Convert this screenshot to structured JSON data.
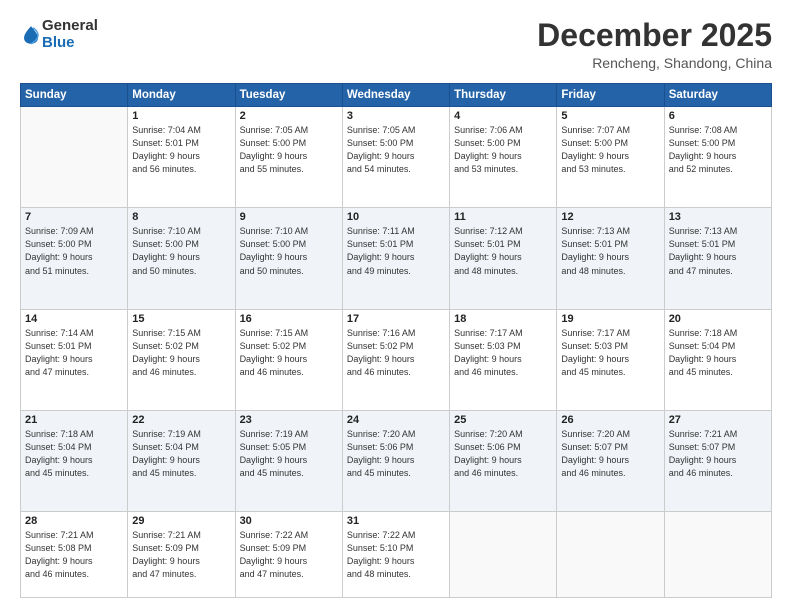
{
  "header": {
    "logo_general": "General",
    "logo_blue": "Blue",
    "month": "December 2025",
    "location": "Rencheng, Shandong, China"
  },
  "days_of_week": [
    "Sunday",
    "Monday",
    "Tuesday",
    "Wednesday",
    "Thursday",
    "Friday",
    "Saturday"
  ],
  "weeks": [
    [
      {
        "day": "",
        "info": ""
      },
      {
        "day": "1",
        "info": "Sunrise: 7:04 AM\nSunset: 5:01 PM\nDaylight: 9 hours\nand 56 minutes."
      },
      {
        "day": "2",
        "info": "Sunrise: 7:05 AM\nSunset: 5:00 PM\nDaylight: 9 hours\nand 55 minutes."
      },
      {
        "day": "3",
        "info": "Sunrise: 7:05 AM\nSunset: 5:00 PM\nDaylight: 9 hours\nand 54 minutes."
      },
      {
        "day": "4",
        "info": "Sunrise: 7:06 AM\nSunset: 5:00 PM\nDaylight: 9 hours\nand 53 minutes."
      },
      {
        "day": "5",
        "info": "Sunrise: 7:07 AM\nSunset: 5:00 PM\nDaylight: 9 hours\nand 53 minutes."
      },
      {
        "day": "6",
        "info": "Sunrise: 7:08 AM\nSunset: 5:00 PM\nDaylight: 9 hours\nand 52 minutes."
      }
    ],
    [
      {
        "day": "7",
        "info": "Sunrise: 7:09 AM\nSunset: 5:00 PM\nDaylight: 9 hours\nand 51 minutes."
      },
      {
        "day": "8",
        "info": "Sunrise: 7:10 AM\nSunset: 5:00 PM\nDaylight: 9 hours\nand 50 minutes."
      },
      {
        "day": "9",
        "info": "Sunrise: 7:10 AM\nSunset: 5:00 PM\nDaylight: 9 hours\nand 50 minutes."
      },
      {
        "day": "10",
        "info": "Sunrise: 7:11 AM\nSunset: 5:01 PM\nDaylight: 9 hours\nand 49 minutes."
      },
      {
        "day": "11",
        "info": "Sunrise: 7:12 AM\nSunset: 5:01 PM\nDaylight: 9 hours\nand 48 minutes."
      },
      {
        "day": "12",
        "info": "Sunrise: 7:13 AM\nSunset: 5:01 PM\nDaylight: 9 hours\nand 48 minutes."
      },
      {
        "day": "13",
        "info": "Sunrise: 7:13 AM\nSunset: 5:01 PM\nDaylight: 9 hours\nand 47 minutes."
      }
    ],
    [
      {
        "day": "14",
        "info": "Sunrise: 7:14 AM\nSunset: 5:01 PM\nDaylight: 9 hours\nand 47 minutes."
      },
      {
        "day": "15",
        "info": "Sunrise: 7:15 AM\nSunset: 5:02 PM\nDaylight: 9 hours\nand 46 minutes."
      },
      {
        "day": "16",
        "info": "Sunrise: 7:15 AM\nSunset: 5:02 PM\nDaylight: 9 hours\nand 46 minutes."
      },
      {
        "day": "17",
        "info": "Sunrise: 7:16 AM\nSunset: 5:02 PM\nDaylight: 9 hours\nand 46 minutes."
      },
      {
        "day": "18",
        "info": "Sunrise: 7:17 AM\nSunset: 5:03 PM\nDaylight: 9 hours\nand 46 minutes."
      },
      {
        "day": "19",
        "info": "Sunrise: 7:17 AM\nSunset: 5:03 PM\nDaylight: 9 hours\nand 45 minutes."
      },
      {
        "day": "20",
        "info": "Sunrise: 7:18 AM\nSunset: 5:04 PM\nDaylight: 9 hours\nand 45 minutes."
      }
    ],
    [
      {
        "day": "21",
        "info": "Sunrise: 7:18 AM\nSunset: 5:04 PM\nDaylight: 9 hours\nand 45 minutes."
      },
      {
        "day": "22",
        "info": "Sunrise: 7:19 AM\nSunset: 5:04 PM\nDaylight: 9 hours\nand 45 minutes."
      },
      {
        "day": "23",
        "info": "Sunrise: 7:19 AM\nSunset: 5:05 PM\nDaylight: 9 hours\nand 45 minutes."
      },
      {
        "day": "24",
        "info": "Sunrise: 7:20 AM\nSunset: 5:06 PM\nDaylight: 9 hours\nand 45 minutes."
      },
      {
        "day": "25",
        "info": "Sunrise: 7:20 AM\nSunset: 5:06 PM\nDaylight: 9 hours\nand 46 minutes."
      },
      {
        "day": "26",
        "info": "Sunrise: 7:20 AM\nSunset: 5:07 PM\nDaylight: 9 hours\nand 46 minutes."
      },
      {
        "day": "27",
        "info": "Sunrise: 7:21 AM\nSunset: 5:07 PM\nDaylight: 9 hours\nand 46 minutes."
      }
    ],
    [
      {
        "day": "28",
        "info": "Sunrise: 7:21 AM\nSunset: 5:08 PM\nDaylight: 9 hours\nand 46 minutes."
      },
      {
        "day": "29",
        "info": "Sunrise: 7:21 AM\nSunset: 5:09 PM\nDaylight: 9 hours\nand 47 minutes."
      },
      {
        "day": "30",
        "info": "Sunrise: 7:22 AM\nSunset: 5:09 PM\nDaylight: 9 hours\nand 47 minutes."
      },
      {
        "day": "31",
        "info": "Sunrise: 7:22 AM\nSunset: 5:10 PM\nDaylight: 9 hours\nand 48 minutes."
      },
      {
        "day": "",
        "info": ""
      },
      {
        "day": "",
        "info": ""
      },
      {
        "day": "",
        "info": ""
      }
    ]
  ]
}
